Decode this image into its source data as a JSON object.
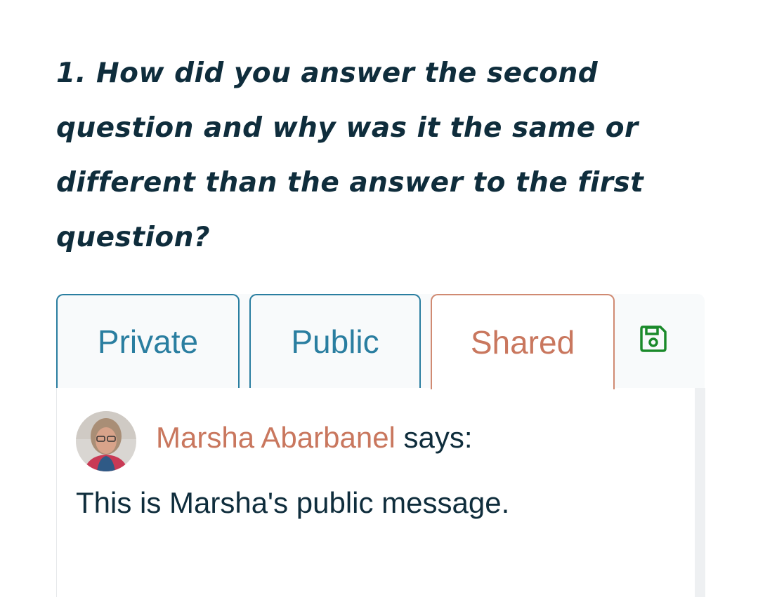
{
  "question": {
    "text": "1. How did you answer the second question and why was it the same or different than the answer to the first question?"
  },
  "tabs": {
    "items": [
      {
        "label": "Private",
        "active": false
      },
      {
        "label": "Public",
        "active": false
      },
      {
        "label": "Shared",
        "active": true
      }
    ],
    "save_icon": "floppy-disk-icon"
  },
  "comment": {
    "author": "Marsha Abarbanel",
    "says": " says:",
    "message": "This is Marsha's public message."
  },
  "colors": {
    "heading": "#0f2d3c",
    "tab_blue": "#2a7ea0",
    "tab_active": "#c9775e",
    "save_green": "#1a8a2a"
  }
}
